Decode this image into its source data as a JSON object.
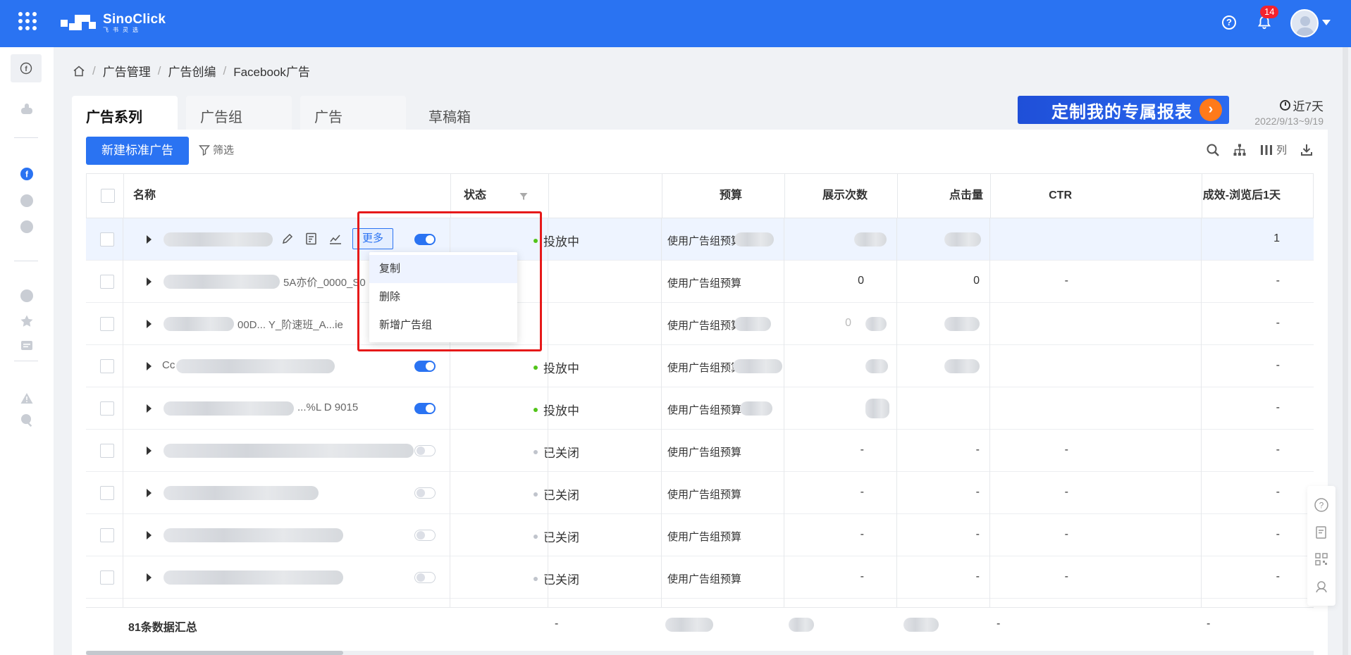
{
  "app": {
    "logo_main": "SinoClick",
    "logo_sub": "飞书灵选",
    "notifications": "14"
  },
  "breadcrumb": [
    "广告管理",
    "广告创编",
    "Facebook广告"
  ],
  "tabs": [
    {
      "label": "广告系列",
      "active": true
    },
    {
      "label": "广告组",
      "active": false
    },
    {
      "label": "广告",
      "active": false
    },
    {
      "label": "草稿箱",
      "active": false
    }
  ],
  "banner": {
    "text": "定制我的专属报表"
  },
  "date_range": {
    "label": "近7天",
    "range": "2022/9/13~9/19"
  },
  "toolbar": {
    "new_button": "新建标准广告",
    "filter": "筛选",
    "columns": "列"
  },
  "table": {
    "headers": {
      "name": "名称",
      "status": "状态",
      "budget": "预算",
      "impressions": "展示次数",
      "clicks": "点击量",
      "ctr": "CTR",
      "results": "成效-浏览后1天"
    },
    "more_button": "更多",
    "rows": [
      {
        "name": "",
        "status": "投放中",
        "budget": "使用广告组预算",
        "impressions": "",
        "clicks": "",
        "ctr": "",
        "results": "1"
      },
      {
        "name": "5A亦价_0000_S0",
        "status": "",
        "budget": "使用广告组预算",
        "impressions": "0",
        "clicks": "0",
        "ctr": "-",
        "results": "-"
      },
      {
        "name": "00D... Y_阶速班_A...ie",
        "status": "",
        "budget": "使用广告组预算",
        "impressions": "0",
        "clicks": "",
        "ctr": "",
        "results": "-"
      },
      {
        "name": "Cc",
        "status": "投放中",
        "budget": "使用广告组预算",
        "impressions": "",
        "clicks": "",
        "ctr": "",
        "results": "-"
      },
      {
        "name": "...%L D 9015",
        "status": "投放中",
        "budget": "使用广告组预算",
        "impressions": "",
        "clicks": "",
        "ctr": "",
        "results": "-"
      },
      {
        "name": "",
        "status": "已关闭",
        "budget": "使用广告组预算",
        "impressions": "-",
        "clicks": "-",
        "ctr": "-",
        "results": "-"
      },
      {
        "name": "",
        "status": "已关闭",
        "budget": "使用广告组预算",
        "impressions": "-",
        "clicks": "-",
        "ctr": "-",
        "results": "-"
      },
      {
        "name": "",
        "status": "已关闭",
        "budget": "使用广告组预算",
        "impressions": "-",
        "clicks": "-",
        "ctr": "-",
        "results": "-"
      },
      {
        "name": "",
        "status": "已关闭",
        "budget": "使用广告组预算",
        "impressions": "-",
        "clicks": "-",
        "ctr": "-",
        "results": "-"
      }
    ],
    "summary": {
      "label": "81条数据汇总",
      "budget": "-",
      "ctr": "-",
      "results": "-"
    }
  },
  "dropdown": {
    "items": [
      "复制",
      "删除",
      "新增广告组"
    ]
  }
}
